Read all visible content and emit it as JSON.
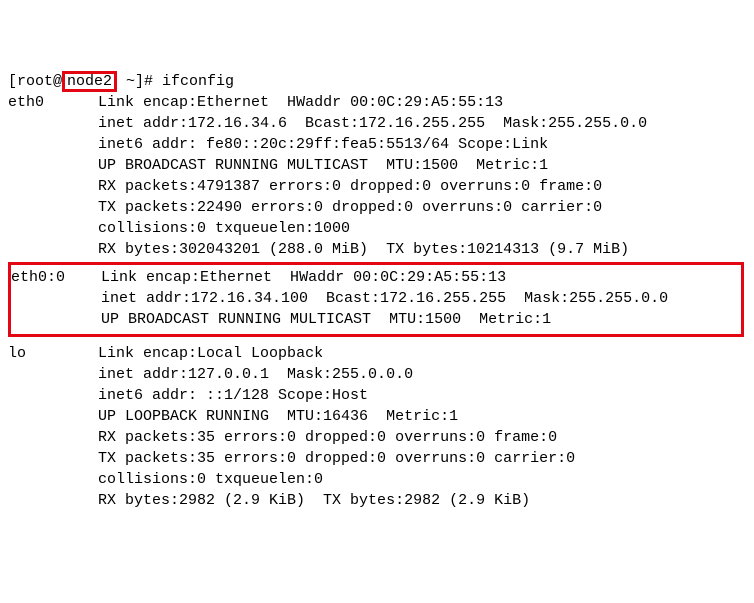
{
  "prompt": {
    "prefix": "[root@",
    "hostname": "node2",
    "suffix": " ~]# ",
    "command": "ifconfig"
  },
  "eth0": {
    "name": "eth0",
    "l1": "Link encap:Ethernet  HWaddr 00:0C:29:A5:55:13",
    "l2": "inet addr:172.16.34.6  Bcast:172.16.255.255  Mask:255.255.0.0",
    "l3": "inet6 addr: fe80::20c:29ff:fea5:5513/64 Scope:Link",
    "l4": "UP BROADCAST RUNNING MULTICAST  MTU:1500  Metric:1",
    "l5": "RX packets:4791387 errors:0 dropped:0 overruns:0 frame:0",
    "l6": "TX packets:22490 errors:0 dropped:0 overruns:0 carrier:0",
    "l7": "collisions:0 txqueuelen:1000",
    "l8": "RX bytes:302043201 (288.0 MiB)  TX bytes:10214313 (9.7 MiB)"
  },
  "eth00": {
    "name": "eth0:0",
    "l1": "Link encap:Ethernet  HWaddr 00:0C:29:A5:55:13",
    "l2": "inet addr:172.16.34.100  Bcast:172.16.255.255  Mask:255.255.0.0",
    "l3": "UP BROADCAST RUNNING MULTICAST  MTU:1500  Metric:1"
  },
  "lo": {
    "name": "lo",
    "l1": "Link encap:Local Loopback",
    "l2": "inet addr:127.0.0.1  Mask:255.0.0.0",
    "l3": "inet6 addr: ::1/128 Scope:Host",
    "l4": "UP LOOPBACK RUNNING  MTU:16436  Metric:1",
    "l5": "RX packets:35 errors:0 dropped:0 overruns:0 frame:0",
    "l6": "TX packets:35 errors:0 dropped:0 overruns:0 carrier:0",
    "l7": "collisions:0 txqueuelen:0",
    "l8": "RX bytes:2982 (2.9 KiB)  TX bytes:2982 (2.9 KiB)"
  }
}
